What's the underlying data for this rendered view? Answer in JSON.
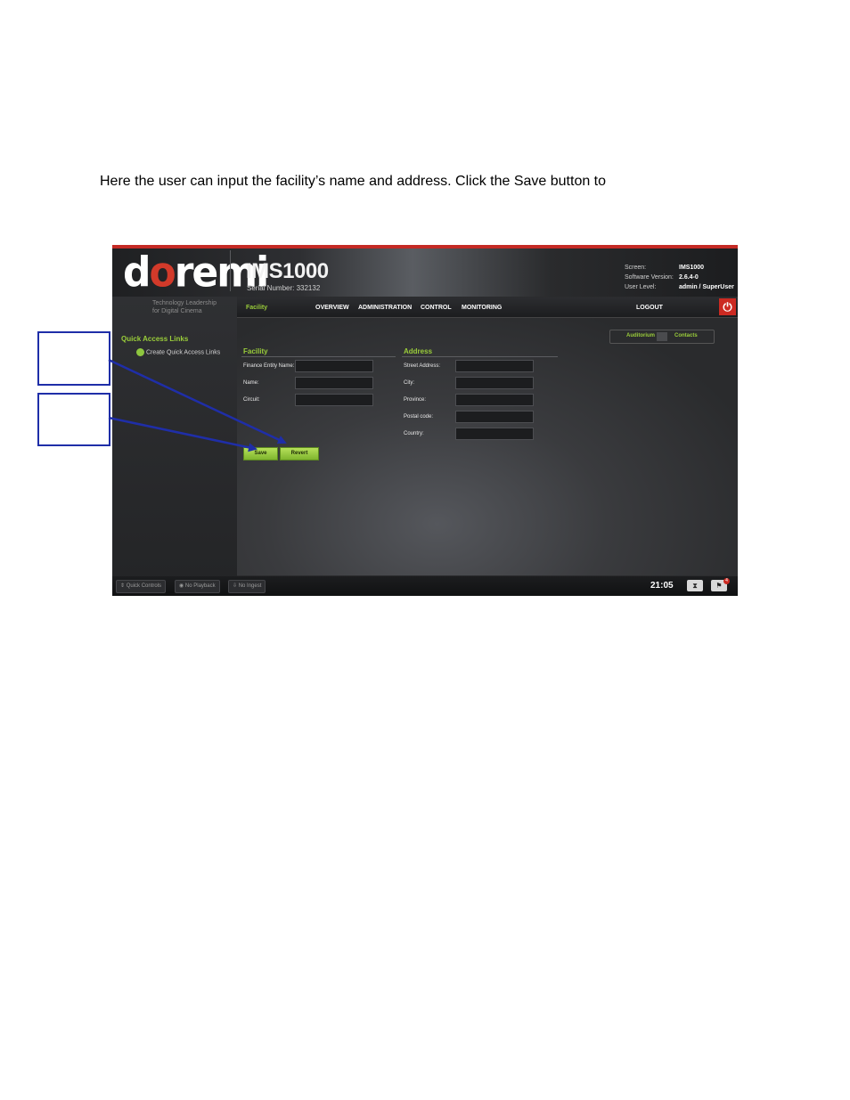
{
  "intro_text": "Here the user can input the facility’s name and address. Click the Save button to",
  "app": {
    "logo": {
      "part1": "d",
      "part2": "o",
      "part3": "remi"
    },
    "product": "IMS1000",
    "serial": "Serial Number: 332132",
    "tagline": [
      "Technology Leadership",
      "for Digital Cinema"
    ],
    "info": {
      "labels": [
        "Screen:",
        "Software Version:",
        "User Level:"
      ],
      "values": [
        "IMS1000",
        "2.6.4-0",
        "admin / SuperUser"
      ]
    },
    "nav": {
      "active": "Facility",
      "items": [
        "OVERVIEW",
        "ADMINISTRATION",
        "CONTROL",
        "MONITORING"
      ],
      "logout": "LOGOUT"
    },
    "sidebar": {
      "heading": "Quick Access Links",
      "link": "Create Quick Access Links"
    },
    "breadcrumb": [
      "Auditorium",
      "Contacts"
    ],
    "facility": {
      "title": "Facility",
      "fields": [
        "Finance Entity Name:",
        "Name:",
        "Circuit:"
      ]
    },
    "address": {
      "title": "Address",
      "fields": [
        "Street Address:",
        "City:",
        "Province:",
        "Postal code:",
        "Country:"
      ]
    },
    "buttons": {
      "save": "Save",
      "revert": "Revert"
    },
    "footer": {
      "quick_controls": "Quick Controls",
      "playback": "No Playback",
      "ingest": "No Ingest",
      "clock": "21:05",
      "notification_count": "4"
    },
    "colors": {
      "accent": "#9acd3a",
      "brand_red": "#c42a25",
      "callout_blue": "#1f2ea8"
    }
  }
}
